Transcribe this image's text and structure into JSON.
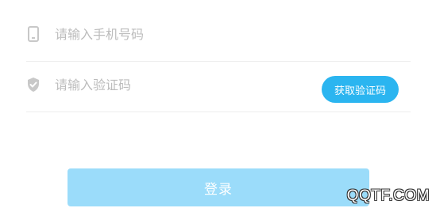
{
  "phone_field": {
    "placeholder": "请输入手机号码",
    "value": "",
    "icon": "phone-icon"
  },
  "code_field": {
    "placeholder": "请输入验证码",
    "value": "",
    "icon": "shield-check-icon"
  },
  "get_code_button": {
    "label": "获取验证码"
  },
  "login_button": {
    "label": "登录"
  },
  "watermark": {
    "text": "QQTF.COM"
  },
  "colors": {
    "accent": "#2bb5f0",
    "login_disabled": "#9bdcfa",
    "placeholder": "#bcbcbc",
    "divider": "#ececec",
    "icon": "#c8c8c8"
  }
}
